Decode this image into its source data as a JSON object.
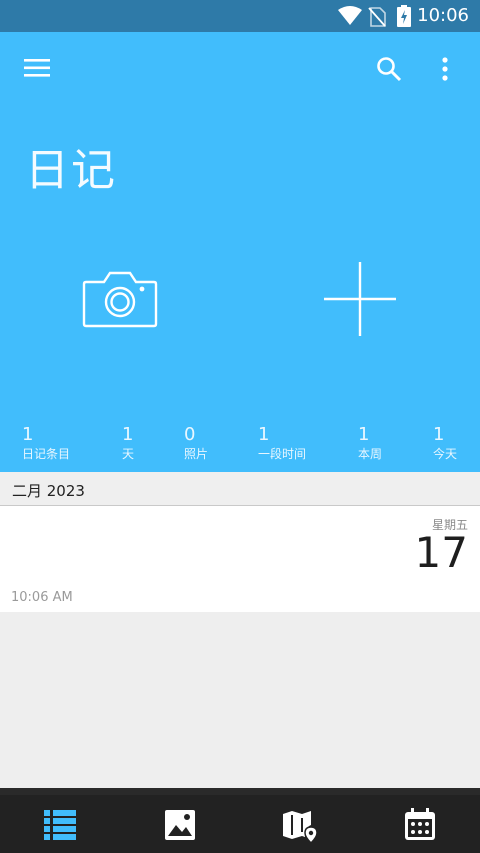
{
  "status_bar": {
    "time": "10:06"
  },
  "header": {
    "title": "日记",
    "stats": [
      {
        "value": "1",
        "label": "日记条目"
      },
      {
        "value": "1",
        "label": "天"
      },
      {
        "value": "0",
        "label": "照片"
      },
      {
        "value": "1",
        "label": "一段时间"
      },
      {
        "value": "1",
        "label": "本周"
      },
      {
        "value": "1",
        "label": "今天"
      }
    ]
  },
  "month_section": {
    "label": "二月 2023"
  },
  "entry": {
    "weekday": "星期五",
    "day": "17",
    "time": "10:06 AM"
  },
  "colors": {
    "header": "#41bdfc",
    "statusbar": "#2e7aa8",
    "nav_active": "#41bdfc",
    "nav_bg": "#222222"
  },
  "bottom_nav": {
    "items": [
      "list-icon",
      "image-icon",
      "map-icon",
      "calendar-icon"
    ],
    "active": "list-icon"
  }
}
